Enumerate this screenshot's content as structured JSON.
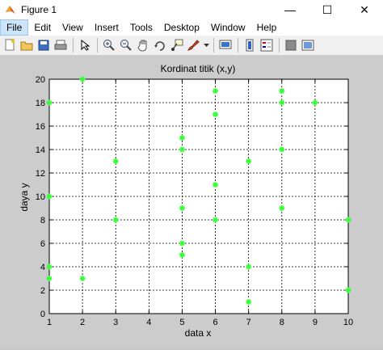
{
  "window": {
    "title": "Figure 1"
  },
  "window_controls": {
    "minimize": "—",
    "maximize": "☐",
    "close": "✕"
  },
  "menu": [
    "File",
    "Edit",
    "View",
    "Insert",
    "Tools",
    "Desktop",
    "Window",
    "Help"
  ],
  "toolbar": {
    "icons": [
      "new-figure-icon",
      "open-file-icon",
      "save-icon",
      "print-icon",
      "edit-plot-arrow-icon",
      "zoom-in-icon",
      "zoom-out-icon",
      "pan-hand-icon",
      "rotate-3d-icon",
      "data-cursor-icon",
      "brush-icon",
      "link-plot-icon",
      "colorbar-icon",
      "legend-icon",
      "hide-plot-tools-icon",
      "show-plot-tools-icon"
    ]
  },
  "colors": {
    "marker": "#33ff33",
    "axes_bg": "#ffffff",
    "figure_bg": "#cccccc"
  },
  "chart_data": {
    "type": "scatter",
    "title": "Kordinat titik (x,y)",
    "xlabel": "data x",
    "ylabel": "daya y",
    "xlim": [
      1,
      10
    ],
    "ylim": [
      0,
      20
    ],
    "xticks": [
      1,
      2,
      3,
      4,
      5,
      6,
      7,
      8,
      9,
      10
    ],
    "yticks": [
      0,
      2,
      4,
      6,
      8,
      10,
      12,
      14,
      16,
      18,
      20
    ],
    "grid": true,
    "marker": "*",
    "points": [
      {
        "x": 1,
        "y": 18
      },
      {
        "x": 1,
        "y": 10
      },
      {
        "x": 1,
        "y": 4
      },
      {
        "x": 1,
        "y": 3
      },
      {
        "x": 2,
        "y": 20
      },
      {
        "x": 2,
        "y": 3
      },
      {
        "x": 3,
        "y": 13
      },
      {
        "x": 3,
        "y": 8
      },
      {
        "x": 5,
        "y": 15
      },
      {
        "x": 5,
        "y": 14
      },
      {
        "x": 5,
        "y": 9
      },
      {
        "x": 5,
        "y": 6
      },
      {
        "x": 5,
        "y": 5
      },
      {
        "x": 6,
        "y": 19
      },
      {
        "x": 6,
        "y": 17
      },
      {
        "x": 6,
        "y": 11
      },
      {
        "x": 6,
        "y": 8
      },
      {
        "x": 7,
        "y": 13
      },
      {
        "x": 7,
        "y": 4
      },
      {
        "x": 7,
        "y": 1
      },
      {
        "x": 8,
        "y": 19
      },
      {
        "x": 8,
        "y": 18
      },
      {
        "x": 8,
        "y": 14
      },
      {
        "x": 8,
        "y": 9
      },
      {
        "x": 9,
        "y": 18
      },
      {
        "x": 10,
        "y": 8
      },
      {
        "x": 10,
        "y": 2
      }
    ]
  }
}
